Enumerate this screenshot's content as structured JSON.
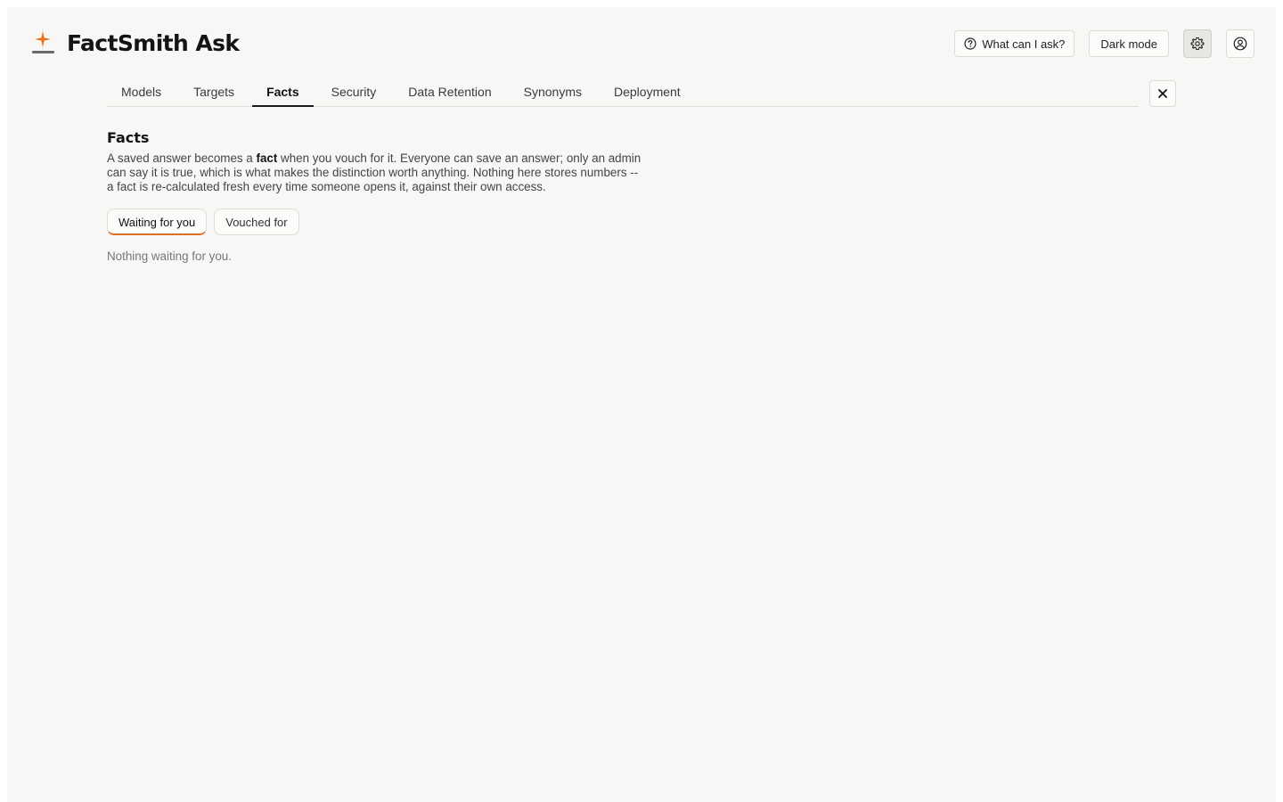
{
  "brand": {
    "title": "FactSmith Ask",
    "logo_icon": "spark-icon",
    "accent_color": "#e8701e"
  },
  "header": {
    "help_label": "What can I ask?",
    "help_icon": "question-circle-icon",
    "dark_mode_label": "Dark mode",
    "settings_icon": "gear-icon",
    "user_icon": "user-circle-icon"
  },
  "tabs": [
    {
      "label": "Models",
      "active": false
    },
    {
      "label": "Targets",
      "active": false
    },
    {
      "label": "Facts",
      "active": true
    },
    {
      "label": "Security",
      "active": false
    },
    {
      "label": "Data Retention",
      "active": false
    },
    {
      "label": "Synonyms",
      "active": false
    },
    {
      "label": "Deployment",
      "active": false
    }
  ],
  "close_icon": "close-icon",
  "facts": {
    "title": "Facts",
    "description_pre": "A saved answer becomes a ",
    "description_bold": "fact",
    "description_post": " when you vouch for it. Everyone can save an answer; only an admin can say it is true, which is what makes the distinction worth anything. Nothing here stores numbers -- a fact is re-calculated fresh every time someone opens it, against their own access.",
    "filters": [
      {
        "label": "Waiting for you",
        "active": true
      },
      {
        "label": "Vouched for",
        "active": false
      }
    ],
    "empty_message": "Nothing waiting for you."
  }
}
